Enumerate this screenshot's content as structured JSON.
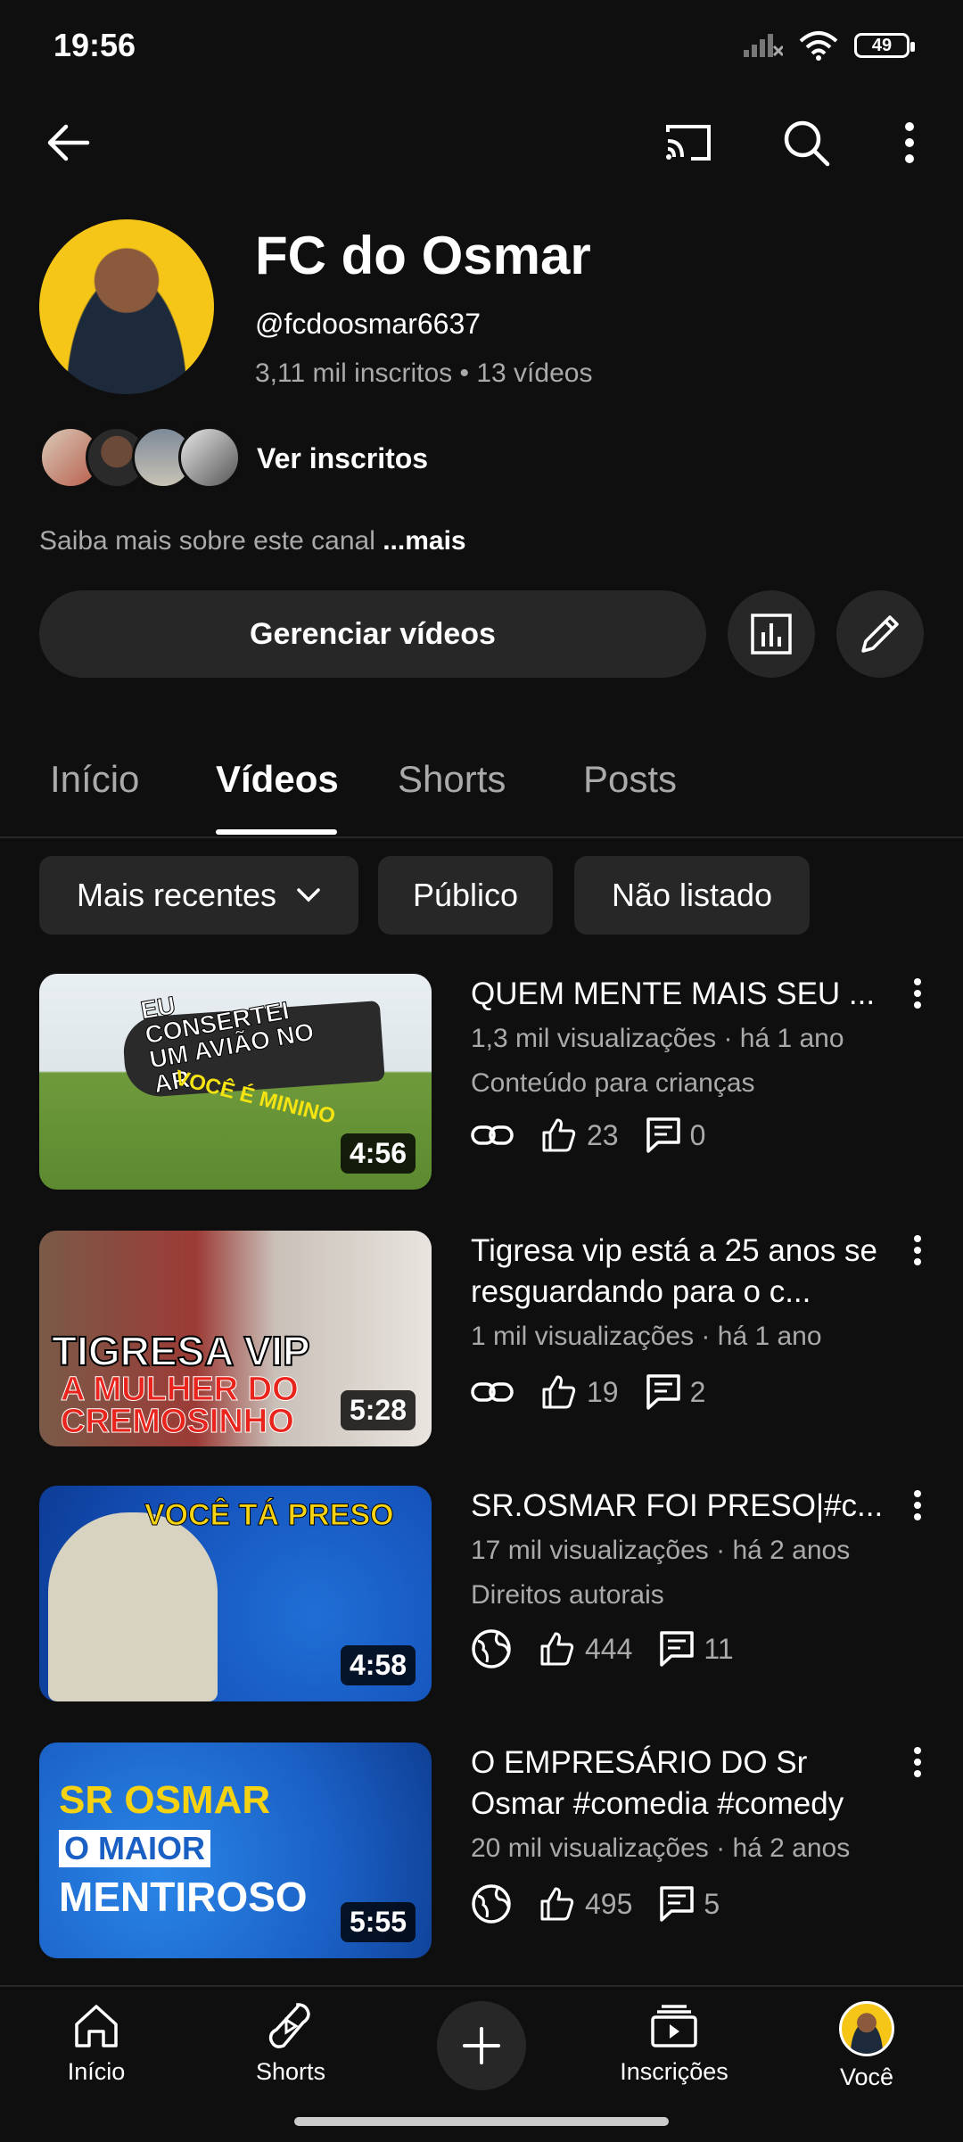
{
  "status_bar": {
    "time": "19:56",
    "battery": "49"
  },
  "channel": {
    "name": "FC do Osmar",
    "handle": "@fcdoosmar6637",
    "stats": "3,11 mil inscritos • 13 vídeos",
    "ver_inscritos": "Ver inscritos",
    "about": "Saiba mais sobre este canal ",
    "about_more": "...mais",
    "manage_label": "Gerenciar vídeos"
  },
  "tabs": [
    "Início",
    "Vídeos",
    "Shorts",
    "Posts"
  ],
  "chips": {
    "sort": "Mais recentes",
    "public": "Público",
    "unlisted": "Não listado"
  },
  "videos": [
    {
      "title": "QUEM MENTE MAIS SEU ...",
      "meta": "1,3 mil visualizações · há 1 ano",
      "extra": "Conteúdo para crianças",
      "duration": "4:56",
      "likes": "23",
      "comments": "0",
      "visibility_icon": "link-icon",
      "thumb_text": "EU CONSERTEI UM AVIÃO NO AR",
      "thumb_text2": "VOCÊ É MININO"
    },
    {
      "title": "Tigresa vip está a 25 anos se resguardando para o c...",
      "meta": "1 mil visualizações · há 1 ano",
      "extra": "",
      "duration": "5:28",
      "likes": "19",
      "comments": "2",
      "visibility_icon": "link-icon",
      "thumb_text": "TIGRESA VIP",
      "thumb_text2": "A MULHER DO CREMOSINHO"
    },
    {
      "title": "SR.OSMAR FOI PRESO|#c...",
      "meta": "17 mil visualizações · há 2 anos",
      "extra": "Direitos autorais",
      "duration": "4:58",
      "likes": "444",
      "comments": "11",
      "visibility_icon": "globe-icon",
      "thumb_text": "VOCÊ TÁ PRESO"
    },
    {
      "title": "O EMPRESÁRIO DO Sr Osmar #comedia #comedy",
      "meta": "20 mil visualizações · há 2 anos",
      "extra": "",
      "duration": "5:55",
      "likes": "495",
      "comments": "5",
      "visibility_icon": "globe-icon",
      "thumb_text": "SR OSMAR",
      "thumb_text2": "O MAIOR",
      "thumb_text3": "MENTIROSO"
    }
  ],
  "bottom_nav": {
    "home": "Início",
    "shorts": "Shorts",
    "subscriptions": "Inscrições",
    "you": "Você"
  }
}
